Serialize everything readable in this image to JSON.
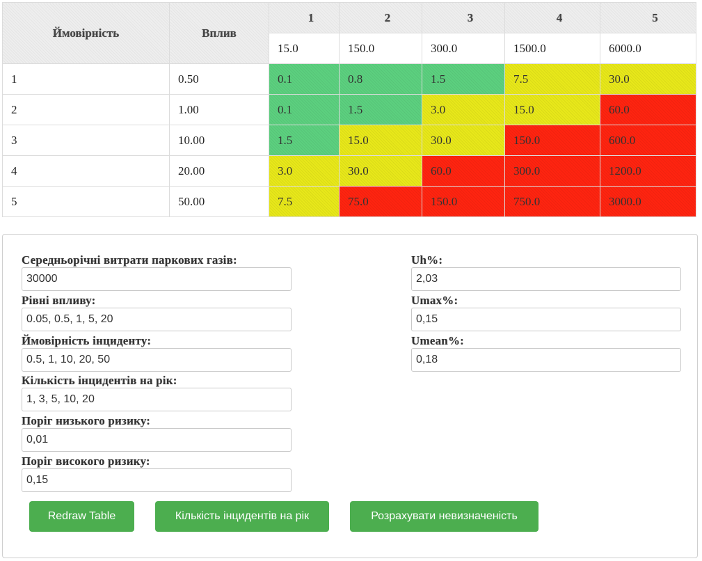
{
  "risk_table": {
    "header": {
      "probability_label": "Ймовірність",
      "impact_label": "Вплив",
      "level_numbers": [
        "1",
        "2",
        "3",
        "4",
        "5"
      ],
      "level_values": [
        "15.0",
        "150.0",
        "300.0",
        "1500.0",
        "6000.0"
      ]
    },
    "rows": [
      {
        "index": "1",
        "probability": "0.50",
        "cells": [
          "0.1",
          "0.8",
          "1.5",
          "7.5",
          "30.0"
        ]
      },
      {
        "index": "2",
        "probability": "1.00",
        "cells": [
          "0.1",
          "1.5",
          "3.0",
          "15.0",
          "60.0"
        ]
      },
      {
        "index": "3",
        "probability": "10.00",
        "cells": [
          "1.5",
          "15.0",
          "30.0",
          "150.0",
          "600.0"
        ]
      },
      {
        "index": "4",
        "probability": "20.00",
        "cells": [
          "3.0",
          "30.0",
          "60.0",
          "300.0",
          "1200.0"
        ]
      },
      {
        "index": "5",
        "probability": "50.00",
        "cells": [
          "7.5",
          "75.0",
          "150.0",
          "750.0",
          "3000.0"
        ]
      }
    ],
    "cell_levels": [
      [
        "green",
        "green",
        "green",
        "yellow",
        "yellow"
      ],
      [
        "green",
        "green",
        "yellow",
        "yellow",
        "red"
      ],
      [
        "green",
        "yellow",
        "yellow",
        "red",
        "red"
      ],
      [
        "yellow",
        "yellow",
        "red",
        "red",
        "red"
      ],
      [
        "yellow",
        "red",
        "red",
        "red",
        "red"
      ]
    ],
    "colors": {
      "green": "#5cd07f",
      "yellow": "#e8e81a",
      "red": "#ff2410"
    }
  },
  "form": {
    "fields": [
      {
        "label": "Середньорічні витрати паркових газів:",
        "value": "30000"
      },
      {
        "label": "Рівні впливу:",
        "value": "0.05, 0.5, 1, 5, 20"
      },
      {
        "label": "Ймовірність інциденту:",
        "value": "0.5, 1, 10, 20, 50"
      },
      {
        "label": "Кількість інцидентів на рік:",
        "value": "1, 3, 5, 10, 20"
      },
      {
        "label": "Поріг низького ризику:",
        "value": "0,01"
      },
      {
        "label": "Поріг високого ризику:",
        "value": "0,15"
      }
    ],
    "results": [
      {
        "label": "Uh%:",
        "value": "2,03"
      },
      {
        "label": "Umax%:",
        "value": "0,15"
      },
      {
        "label": "Umean%:",
        "value": "0,18"
      }
    ],
    "buttons": {
      "redraw": "Redraw Table",
      "incidents": "Кількість інцидентів на рік",
      "uncertainty": "Розрахувати невизначеність"
    },
    "accent_color": "#4cae4f"
  }
}
